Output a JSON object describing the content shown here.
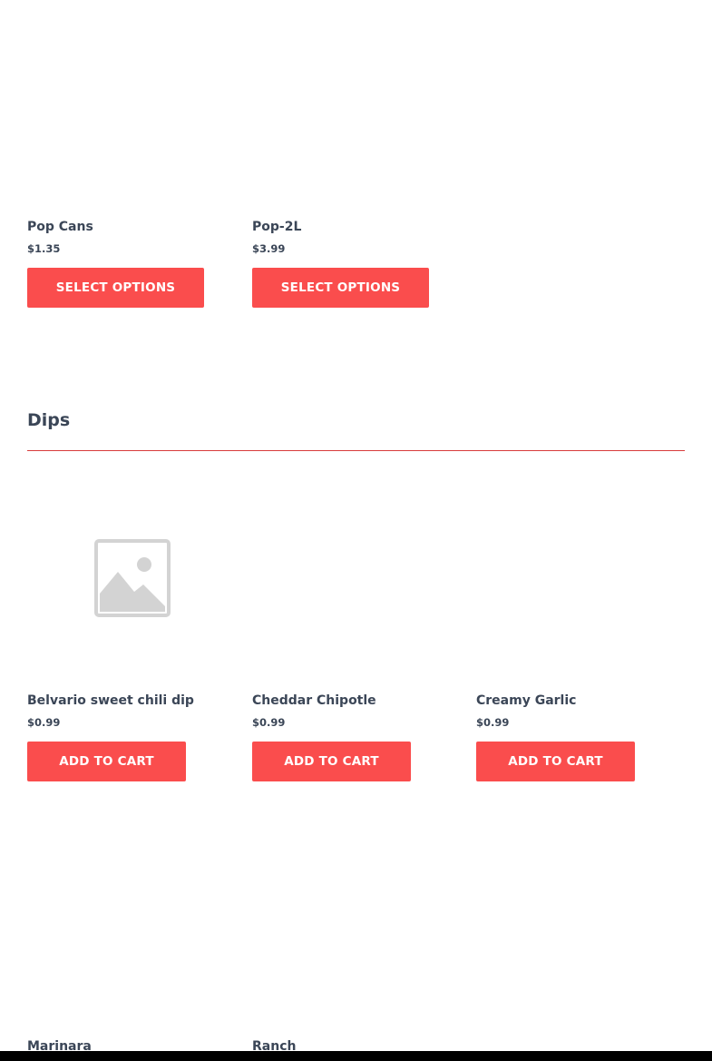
{
  "sections": {
    "drinks": {
      "products": [
        {
          "name": "Pop Cans",
          "price": "$1.35",
          "button": "SELECT OPTIONS"
        },
        {
          "name": "Pop-2L",
          "price": "$3.99",
          "button": "SELECT OPTIONS"
        }
      ]
    },
    "dips": {
      "title": "Dips",
      "products": [
        {
          "name": "Belvario sweet chili dip",
          "price": "$0.99",
          "button": "ADD TO CART",
          "image": "placeholder-image-icon"
        },
        {
          "name": "Cheddar Chipotle",
          "price": "$0.99",
          "button": "ADD TO CART"
        },
        {
          "name": "Creamy Garlic",
          "price": "$0.99",
          "button": "ADD TO CART"
        },
        {
          "name": "Marinara"
        },
        {
          "name": "Ranch"
        }
      ]
    }
  },
  "colors": {
    "accent": "#fa4d4d",
    "text": "#3b4657",
    "divider": "#d83c3c",
    "placeholder": "#d3d3d3"
  }
}
